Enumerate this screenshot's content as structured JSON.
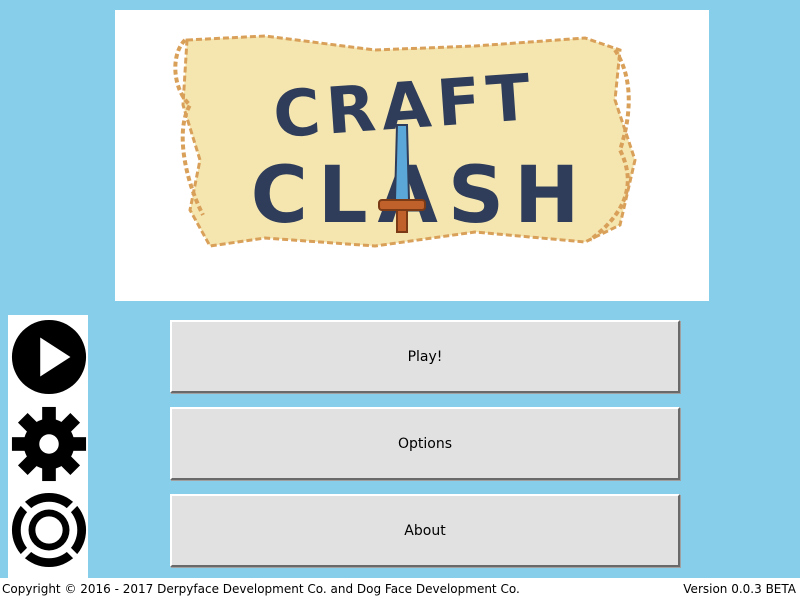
{
  "logo": {
    "line1": "CRAFT",
    "line2": "CLASH"
  },
  "side_icons": {
    "play": "play-icon",
    "settings": "gear-icon",
    "help": "lifebuoy-icon"
  },
  "menu": {
    "play_label": "Play!",
    "options_label": "Options",
    "about_label": "About"
  },
  "footer": {
    "copyright": "Copyright © 2016 - 2017 Derpyface Development Co. and Dog Face Development Co.",
    "version": "Version 0.0.3 BETA"
  },
  "colors": {
    "background": "#87CEEB",
    "scroll": "#F5E6B0",
    "scroll_edge": "#D9A05A",
    "logo_text": "#2F3D5A",
    "sword_blade": "#5BA8D8",
    "sword_hilt": "#C0602A"
  }
}
